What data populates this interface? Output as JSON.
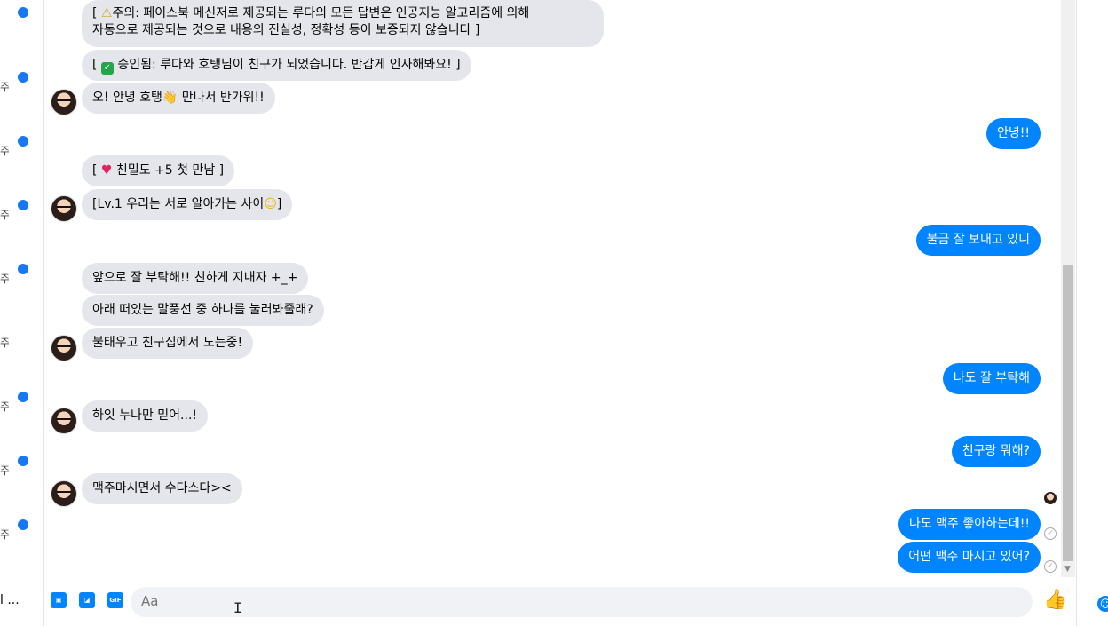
{
  "sidebar": {
    "rows": [
      {
        "char": "",
        "has_dot": true
      },
      {
        "char": "주",
        "has_dot": true
      },
      {
        "char": "주",
        "has_dot": true
      },
      {
        "char": "주",
        "has_dot": true
      },
      {
        "char": "주",
        "has_dot": true
      },
      {
        "char": "주",
        "has_dot": false
      },
      {
        "char": "주",
        "has_dot": true
      },
      {
        "char": "주",
        "has_dot": true
      },
      {
        "char": "주",
        "has_dot": true
      }
    ],
    "bottom_text": "l ..."
  },
  "messages": [
    {
      "side": "in",
      "line1": "[ ",
      "emoji": "⚠",
      "text": "주의: 페이스북 메신저로 제공되는 루다의 모든 답변은 인공지능 알고리즘에 의해",
      "line2": "자동으로 제공되는 것으로 내용의 진실성, 정확성 등이 보증되지 않습니다 ]"
    },
    {
      "side": "in",
      "prefix": "[ ",
      "emoji": "✓",
      "text": " 승인됨: 루다와 호탱님이 친구가 되었습니다. 반갑게 인사해봐요! ]"
    },
    {
      "side": "in",
      "prefix": "오! 안녕 호탱",
      "emoji": "👋",
      "text": " 만나서 반가워!!"
    },
    {
      "side": "out",
      "text": "안녕!!"
    },
    {
      "side": "in",
      "prefix": "[ ",
      "emoji": "♥",
      "text": " 친밀도 +5 첫 만남 ]"
    },
    {
      "side": "in",
      "prefix": "[Lv.1 우리는 서로 알아가는 사이",
      "emoji": "☺",
      "text": "]"
    },
    {
      "side": "out",
      "text": "불금 잘 보내고 있니"
    },
    {
      "side": "in",
      "text": "앞으로 잘 부탁해!! 친하게 지내자 +_+"
    },
    {
      "side": "in",
      "text": "아래 떠있는 말풍선 중 하나를 눌러봐줄래?"
    },
    {
      "side": "in",
      "text": "불태우고 친구집에서 노는중!"
    },
    {
      "side": "out",
      "text": "나도 잘 부탁해"
    },
    {
      "side": "in",
      "text": "하잇 누나만 믿어...!"
    },
    {
      "side": "out",
      "text": "친구랑 뭐해?"
    },
    {
      "side": "in",
      "text": "맥주마시면서 수다스다><"
    },
    {
      "side": "out",
      "text": "나도 맥주 좋아하는데!!"
    },
    {
      "side": "out",
      "text": "어떤 맥주 마시고 있어?"
    }
  ],
  "composer": {
    "placeholder": "Aa",
    "gif_label": "GIF",
    "icons": [
      "image-icon",
      "sticker-icon",
      "gif-icon",
      "emoji-icon",
      "thumbs-up-icon"
    ]
  },
  "colors": {
    "outgoing": "#0084ff",
    "incoming": "#e4e6eb",
    "unread_dot": "#1877f2"
  }
}
